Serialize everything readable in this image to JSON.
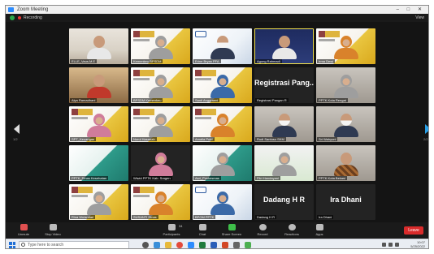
{
  "window": {
    "title": "Zoom Meeting",
    "controls": "– □ ✕"
  },
  "topbar": {
    "recording_label": "Recording",
    "view_label": "View"
  },
  "pager": {
    "left": "1/2",
    "right": "2/2"
  },
  "tiles": [
    {
      "name": "ELLE_Vaus.M.E",
      "style": "office",
      "person": "shirt-white"
    },
    {
      "name": "Kemenkeu BPSDM",
      "style": "banner",
      "person": "hijab grey mask"
    },
    {
      "name": "Erine Bryan PFA",
      "style": "kfi",
      "person": "mask"
    },
    {
      "name": "Agung Rahmadi",
      "style": "navy",
      "person": "shirt-white",
      "active": true
    },
    {
      "name": "Irma Dewi",
      "style": "banner",
      "person": "hijab orange"
    },
    {
      "name": "Alya Ramadhani",
      "style": "shelf",
      "person": "shirt-red"
    },
    {
      "name": "BPSDM Kemenkeu",
      "style": "banner",
      "person": "hijab grey"
    },
    {
      "name": "Santi Anggraeni",
      "style": "banner",
      "person": "hijab blue"
    },
    {
      "name": "Registrasi Pangan R",
      "style": "dark",
      "big": "Registrasi Pang..."
    },
    {
      "name": "PPTK Kota Rengat",
      "style": "room",
      "person": "hijab grey"
    },
    {
      "name": "SPT_Keuangan",
      "style": "banner",
      "person": "hijab pink"
    },
    {
      "name": "Nurul Hasanah",
      "style": "banner",
      "person": "hijab grey"
    },
    {
      "name": "Amalia Putri",
      "style": "banner",
      "person": "hijab orange mask"
    },
    {
      "name": "Rudi Santoso SKM",
      "style": "room",
      "person": "mask"
    },
    {
      "name": "Sri Wahyuni",
      "style": "room",
      "person": "mask"
    },
    {
      "name": "PPTK_Dinas Kesehatan",
      "style": "teal",
      "person": "none"
    },
    {
      "name": "Wiwid PPTK Kab. Sragen",
      "style": "dark",
      "person": "hijab pink"
    },
    {
      "name": "Asri_Puskesmas",
      "style": "teal",
      "person": "hijab grey"
    },
    {
      "name": "Fitri Handayani",
      "style": "green",
      "person": "hijab grey"
    },
    {
      "name": "PPTK Kota Bekasi",
      "style": "room",
      "person": "shirt-batik"
    },
    {
      "name": "Rina Wulandari",
      "style": "banner",
      "person": "hijab grey"
    },
    {
      "name": "SUSANTI Dinas",
      "style": "banner",
      "person": "hijab orange"
    },
    {
      "name": "BPOM PPTK",
      "style": "kfi",
      "person": "hijab blue"
    },
    {
      "name": "Dadang H R",
      "style": "dark",
      "big": "Dadang H R"
    },
    {
      "name": "Ira Dhani",
      "style": "dark",
      "big": "Ira Dhani"
    }
  ],
  "controls": {
    "unmute": "Unmute",
    "start_video": "Stop Video",
    "participants": "Participants",
    "participants_count": "34",
    "chat": "Chat",
    "share": "Share Screen",
    "record": "Record",
    "reactions": "Reactions",
    "apps": "Apps",
    "end": "Leave"
  },
  "taskbar": {
    "search_placeholder": "Type here to search",
    "time": "10:07",
    "date": "5/25/2022"
  }
}
